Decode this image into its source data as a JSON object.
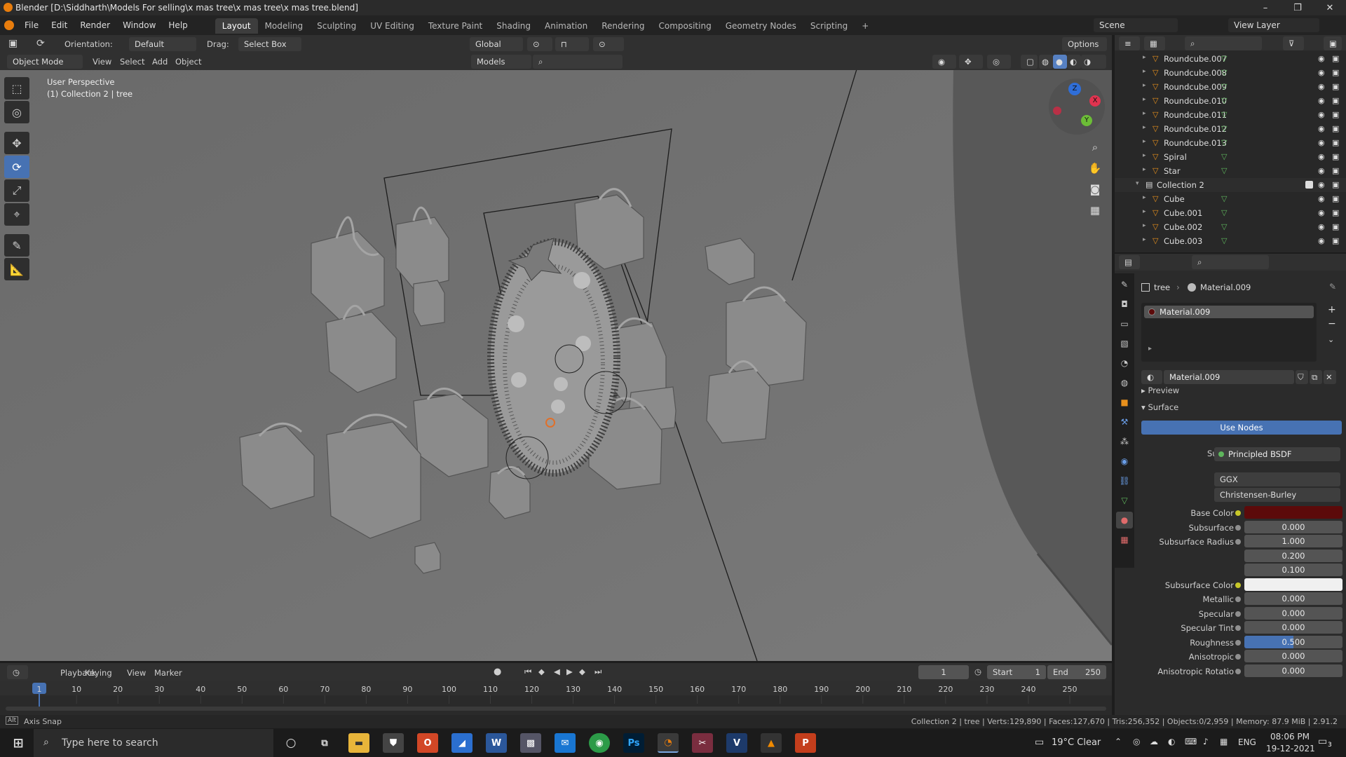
{
  "window": {
    "title": "Blender [D:\\Siddharth\\Models For selling\\x mas tree\\x mas tree\\x mas tree.blend]",
    "controls": [
      "–",
      "❐",
      "✕"
    ]
  },
  "menu": [
    "File",
    "Edit",
    "Render",
    "Window",
    "Help"
  ],
  "workspaces": [
    "Layout",
    "Modeling",
    "Sculpting",
    "UV Editing",
    "Texture Paint",
    "Shading",
    "Animation",
    "Rendering",
    "Compositing",
    "Geometry Nodes",
    "Scripting",
    "+"
  ],
  "scene": {
    "label": "Scene",
    "view_layer": "View Layer"
  },
  "header": {
    "orientation_label": "Orientation:",
    "orientation_value": "Default",
    "drag_label": "Drag:",
    "drag_value": "Select Box",
    "transform_space": "Global",
    "options": "Options"
  },
  "header2": {
    "mode": "Object Mode",
    "menus": [
      "View",
      "Select",
      "Add",
      "Object"
    ],
    "collection_filter": "Models"
  },
  "viewport": {
    "line1": "User Perspective",
    "line2": "(1) Collection 2 | tree",
    "gizmo": {
      "x": "X",
      "y": "Y",
      "z": "Z"
    }
  },
  "outliner": {
    "items": [
      {
        "name": "Roundcube.007",
        "level": 1
      },
      {
        "name": "Roundcube.008",
        "level": 1
      },
      {
        "name": "Roundcube.009",
        "level": 1
      },
      {
        "name": "Roundcube.010",
        "level": 1
      },
      {
        "name": "Roundcube.011",
        "level": 1
      },
      {
        "name": "Roundcube.012",
        "level": 1
      },
      {
        "name": "Roundcube.013",
        "level": 1
      },
      {
        "name": "Spiral",
        "level": 1
      },
      {
        "name": "Star",
        "level": 1
      },
      {
        "name": "Collection 2",
        "level": 0
      },
      {
        "name": "Cube",
        "level": 1
      },
      {
        "name": "Cube.001",
        "level": 1
      },
      {
        "name": "Cube.002",
        "level": 1
      },
      {
        "name": "Cube.003",
        "level": 1
      }
    ]
  },
  "properties": {
    "breadcrumb_object": "tree",
    "breadcrumb_material": "Material.009",
    "slot_name": "Material.009",
    "material_name": "Material.009",
    "preview_label": "Preview",
    "surface_label": "Surface",
    "use_nodes": "Use Nodes",
    "surface_field_label": "Surface",
    "surface_shader": "Principled BSDF",
    "distribution": "GGX",
    "subsurface_method": "Christensen-Burley",
    "rows": [
      {
        "label": "Base Color",
        "value": "",
        "color": "#5c0a0a"
      },
      {
        "label": "Subsurface",
        "value": "0.000"
      },
      {
        "label": "Subsurface Radius",
        "value": "1.000"
      },
      {
        "label": "",
        "value": "0.200"
      },
      {
        "label": "",
        "value": "0.100"
      },
      {
        "label": "Subsurface Color",
        "value": "",
        "color": "#f0f0f0"
      },
      {
        "label": "Metallic",
        "value": "0.000"
      },
      {
        "label": "Specular",
        "value": "0.000"
      },
      {
        "label": "Specular Tint",
        "value": "0.000"
      },
      {
        "label": "Roughness",
        "value": "0.500",
        "fill": 0.5
      },
      {
        "label": "Anisotropic",
        "value": "0.000"
      },
      {
        "label": "Anisotropic Rotatio",
        "value": "0.000"
      }
    ]
  },
  "timeline": {
    "menus": [
      "Playback",
      "Keying",
      "View",
      "Marker"
    ],
    "current_frame": "1",
    "start_label": "Start",
    "start_value": "1",
    "end_label": "End",
    "end_value": "250",
    "ticks": [
      "1",
      "10",
      "20",
      "30",
      "40",
      "50",
      "60",
      "70",
      "80",
      "90",
      "100",
      "110",
      "120",
      "130",
      "140",
      "150",
      "160",
      "170",
      "180",
      "190",
      "200",
      "210",
      "220",
      "230",
      "240",
      "250"
    ]
  },
  "statusbar": {
    "left": "Axis Snap",
    "right": "Collection 2 | tree | Verts:129,890 | Faces:127,670 | Tris:256,352 | Objects:0/2,959 | Memory: 87.9 MiB | 2.91.2"
  },
  "taskbar": {
    "search_placeholder": "Type here to search",
    "weather": "19°C  Clear",
    "lang": "ENG",
    "time": "08:06 PM",
    "date": "19-12-2021",
    "notifications": "3"
  },
  "colors": {
    "accent": "#4772b3",
    "viewport_bg": "#6e6e6e",
    "base_color": "#5c0a0a"
  }
}
